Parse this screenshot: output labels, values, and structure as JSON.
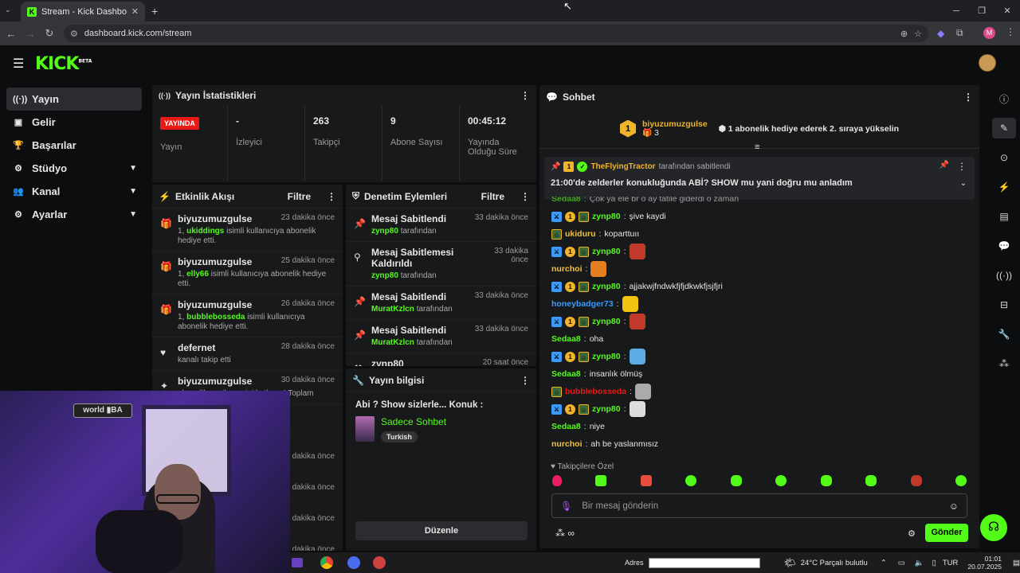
{
  "browser": {
    "tab_title": "Stream - Kick Dashboard",
    "url": "dashboard.kick.com/stream",
    "profile": "M"
  },
  "logo": {
    "text": "KICK",
    "sup": "BETA"
  },
  "sidebar": {
    "items": [
      {
        "label": "Yayın",
        "icon": "broadcast-icon"
      },
      {
        "label": "Gelir",
        "icon": "wallet-icon"
      },
      {
        "label": "Başarılar",
        "icon": "trophy-icon"
      },
      {
        "label": "Stüdyo",
        "icon": "gear-icon"
      },
      {
        "label": "Kanal",
        "icon": "people-icon"
      },
      {
        "label": "Ayarlar",
        "icon": "gear-icon"
      }
    ]
  },
  "stats": {
    "title": "Yayın İstatistikleri",
    "live_badge": "YAYINDA",
    "live_label": "Yayın",
    "items": [
      {
        "value": "-",
        "label": "İzleyici"
      },
      {
        "value": "263",
        "label": "Takipçi"
      },
      {
        "value": "9",
        "label": "Abone Sayısı"
      },
      {
        "value": "00:45:12",
        "label": "Yayında Olduğu Süre"
      }
    ]
  },
  "activity": {
    "title": "Etkinlik Akışı",
    "filter": "Filtre",
    "events": [
      {
        "name": "biyuzumuzgulse",
        "time": "23 dakika önce",
        "pre": "1, ",
        "hl": "ukiddings",
        "post": " isimli kullanıcıya abonelik hediye etti."
      },
      {
        "name": "biyuzumuzgulse",
        "time": "25 dakika önce",
        "pre": "1, ",
        "hl": "elly66",
        "post": " isimli kullanıcıya abonelik hediye etti."
      },
      {
        "name": "biyuzumuzgulse",
        "time": "26 dakika önce",
        "pre": "1, ",
        "hl": "bubblebosseda",
        "post": " isimli kullanıcıya abonelik hediye etti."
      },
      {
        "name": "defernet",
        "time": "28 dakika önce",
        "pre": "kanalı takip etti",
        "hl": "",
        "post": ""
      },
      {
        "name": "biyuzumuzgulse",
        "time": "30 dakika önce",
        "pre": "abonelik yenilemesini kutluyor! Toplam",
        "hl": "",
        "post": ""
      }
    ],
    "extra_times": [
      "2 dakika önce",
      "3 dakika önce",
      "3 dakika önce",
      "3 dakika önce"
    ]
  },
  "moderation": {
    "title": "Denetim Eylemleri",
    "filter": "Filtre",
    "events": [
      {
        "title": "Mesaj Sabitlendi",
        "time": "33 dakika önce",
        "user": "zynp80",
        "suffix": "tarafından"
      },
      {
        "title": "Mesaj Sabitlemesi Kaldırıldı",
        "time": "33 dakika önce",
        "user": "zynp80",
        "suffix": "tarafından"
      },
      {
        "title": "Mesaj Sabitlendi",
        "time": "33 dakika önce",
        "user": "MuratKzlcn",
        "suffix": "tarafından"
      },
      {
        "title": "Mesaj Sabitlendi",
        "time": "33 dakika önce",
        "user": "MuratKzlcn",
        "suffix": "tarafından"
      },
      {
        "title": "zynp80",
        "time": "20 saat önce",
        "user": "",
        "suffix": ""
      }
    ]
  },
  "stream_info": {
    "title": "Yayın bilgisi",
    "stream_title": "Abi ? Show sizlerle... Konuk :",
    "category": "Sadece Sohbet",
    "language": "Turkish",
    "edit": "Düzenle"
  },
  "chat": {
    "title": "Sohbet",
    "gift_user": "biyuzumuzgulse",
    "gift_count": "3",
    "gift_rank": "1",
    "gift_text": "1 abonelik hediye ederek 2. sıraya yükselin",
    "pinned_by_user": "TheFlyingTractor",
    "pinned_by": "tarafından sabitlendi",
    "pinned_text": "21:00'de zelderler konukluğunda ABİ? SHOW mu yani doğru mu anladım",
    "messages": [
      {
        "user": "Sedaa8",
        "color": "#53fc18",
        "text": "Çok ya ele br o ay tatile giderdi o zaman",
        "badges": 0
      },
      {
        "user": "zynp80",
        "color": "#53fc18",
        "text": "şive kaydi",
        "badges": 3
      },
      {
        "user": "ukiduru",
        "color": "#f0c040",
        "text": "koparttuıı",
        "badges": 1
      },
      {
        "user": "zynp80",
        "color": "#53fc18",
        "text": "",
        "badges": 3,
        "emote": "#c0392b"
      },
      {
        "user": "nurchoi",
        "color": "#f0c040",
        "text": "",
        "badges": 0,
        "emote": "#e67e22"
      },
      {
        "user": "zynp80",
        "color": "#53fc18",
        "text": "ajjakwjfndwkfjfjdkwkfjsjfjri",
        "badges": 3
      },
      {
        "user": "honeybadger73",
        "color": "#3a9bfc",
        "text": "",
        "badges": 0,
        "emote": "#f1c40f"
      },
      {
        "user": "zynp80",
        "color": "#53fc18",
        "text": "",
        "badges": 3,
        "emote": "#c0392b"
      },
      {
        "user": "Sedaa8",
        "color": "#53fc18",
        "text": "oha",
        "badges": 0
      },
      {
        "user": "zynp80",
        "color": "#53fc18",
        "text": "",
        "badges": 3,
        "emote": "#5dade2"
      },
      {
        "user": "Sedaa8",
        "color": "#53fc18",
        "text": "insanlık ölmüş",
        "badges": 0
      },
      {
        "user": "bubblebosseda",
        "color": "#e91916",
        "text": "",
        "badges": 1,
        "emote": "#aaaaaa"
      },
      {
        "user": "zynp80",
        "color": "#53fc18",
        "text": "",
        "badges": 3,
        "emote": "#dddddd"
      },
      {
        "user": "Sedaa8",
        "color": "#53fc18",
        "text": "niye",
        "badges": 0
      },
      {
        "user": "nurchoi",
        "color": "#f0c040",
        "text": "ah be yaslanmısız",
        "badges": 0
      }
    ],
    "followers_only": "Takipçilere Özel",
    "placeholder": "Bir mesaj gönderin",
    "send": "Gönder"
  },
  "taskbar": {
    "address_label": "Adres",
    "weather": "24°C  Parçalı bulutlu",
    "lang": "TUR",
    "time": "01:01",
    "date": "20.07.2025"
  }
}
